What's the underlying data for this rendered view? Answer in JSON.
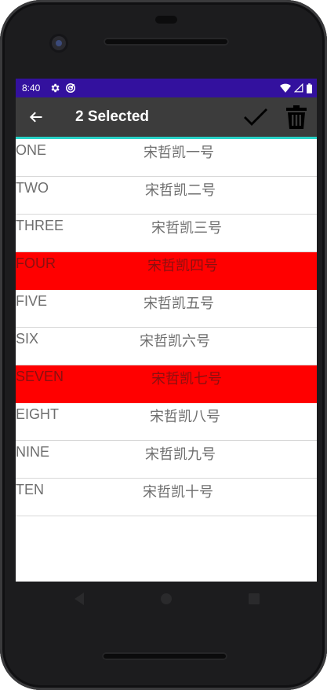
{
  "status_bar": {
    "time": "8:40"
  },
  "action_bar": {
    "title": "2 Selected"
  },
  "list": {
    "rows": [
      {
        "en": "ONE",
        "zh": "宋哲凯一号",
        "selected": false
      },
      {
        "en": "TWO",
        "zh": "宋哲凯二号",
        "selected": false
      },
      {
        "en": "THREE",
        "zh": "宋哲凯三号",
        "selected": false
      },
      {
        "en": "FOUR",
        "zh": "宋哲凯四号",
        "selected": true
      },
      {
        "en": "FIVE",
        "zh": "宋哲凯五号",
        "selected": false
      },
      {
        "en": "SIX",
        "zh": "宋哲凯六号",
        "selected": false
      },
      {
        "en": "SEVEN",
        "zh": "宋哲凯七号",
        "selected": true
      },
      {
        "en": "EIGHT",
        "zh": "宋哲凯八号",
        "selected": false
      },
      {
        "en": "NINE",
        "zh": "宋哲凯九号",
        "selected": false
      },
      {
        "en": "TEN",
        "zh": "宋哲凯十号",
        "selected": false
      }
    ]
  },
  "icons": {
    "back": "arrow-back-icon",
    "confirm": "check-icon",
    "delete": "trash-icon"
  },
  "colors": {
    "status_bar": "#33119e",
    "action_bar": "#3c3c3c",
    "accent_line": "#29d3c8",
    "selected_row": "#ff0000"
  }
}
